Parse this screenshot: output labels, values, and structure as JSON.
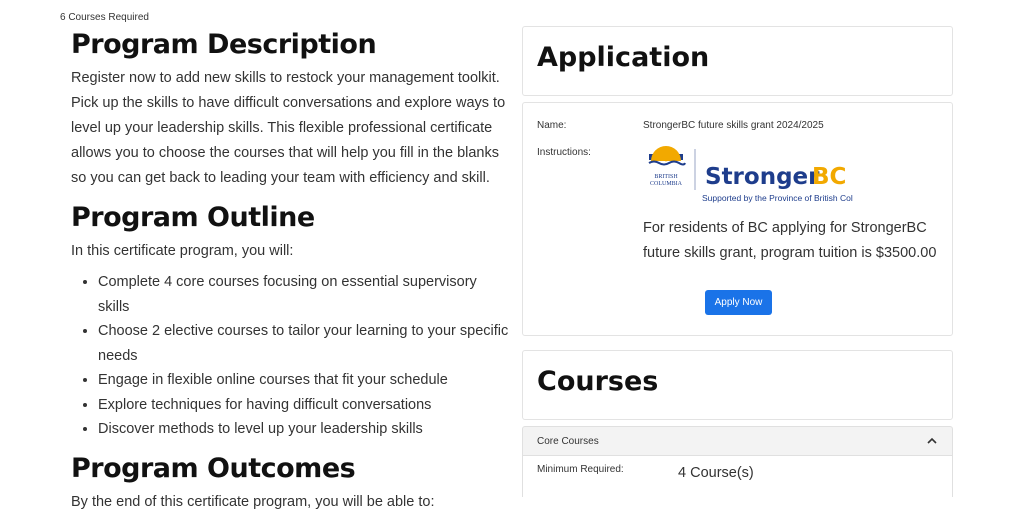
{
  "header": {
    "courses_required": "6 Courses Required"
  },
  "description": {
    "title": "Program Description",
    "text": "Register now to add new skills to restock your management toolkit. Pick up the skills to have difficult conversations and explore ways to level up your leadership skills. This flexible professional certificate allows you to choose the courses that will help you fill in the blanks so you can get back to leading your team with efficiency and skill."
  },
  "outline": {
    "title": "Program Outline",
    "intro": "In this certificate program, you will:",
    "items": [
      "Complete 4 core courses focusing on essential supervisory skills",
      "Choose 2 elective courses to tailor your learning to your specific needs",
      "Engage in flexible online courses that fit your schedule",
      "Explore techniques for having difficult conversations",
      "Discover methods to level up your leadership skills"
    ]
  },
  "outcomes": {
    "title": "Program Outcomes",
    "intro": "By the end of this certificate program, you will be able to:"
  },
  "application": {
    "title": "Application",
    "name_label": "Name:",
    "name_value": "StrongerBC future skills grant 2024/2025",
    "instructions_label": "Instructions:",
    "logo": {
      "british": "BRITISH",
      "columbia": "COLUMBIA",
      "stronger": "Stronger",
      "bc": "BC",
      "tagline": "Supported by the Province of British Columbia"
    },
    "grant_text": "For residents of BC applying for  StrongerBC future skills grant, program tuition is $3500.00",
    "apply_label": "Apply Now",
    "apply_color": "#1a73e8"
  },
  "courses": {
    "title": "Courses",
    "core_label": "Core Courses",
    "min_required_label": "Minimum Required:",
    "min_required_value": "4 Course(s)"
  }
}
